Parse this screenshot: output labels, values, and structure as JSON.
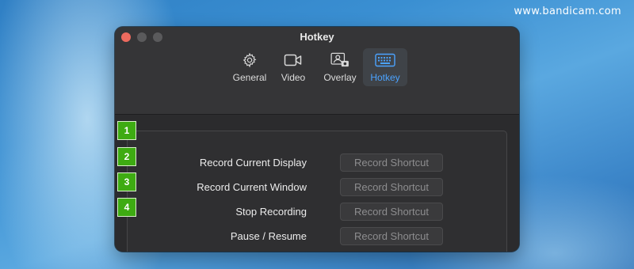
{
  "watermark": "www.bandicam.com",
  "window": {
    "title": "Hotkey"
  },
  "tabs": [
    {
      "label": "General",
      "icon": "gear-icon",
      "active": false
    },
    {
      "label": "Video",
      "icon": "video-camera-icon",
      "active": false
    },
    {
      "label": "Overlay",
      "icon": "overlay-photo-icon",
      "active": false
    },
    {
      "label": "Hotkey",
      "icon": "keyboard-icon",
      "active": true
    }
  ],
  "hotkeys": [
    {
      "badge": "1",
      "label": "Record Current Display",
      "button": "Record Shortcut"
    },
    {
      "badge": "2",
      "label": "Record Current Window",
      "button": "Record Shortcut"
    },
    {
      "badge": "3",
      "label": "Stop Recording",
      "button": "Record Shortcut"
    },
    {
      "badge": "4",
      "label": "Pause / Resume",
      "button": "Record Shortcut"
    }
  ],
  "colors": {
    "accent": "#4ba3ff",
    "badge": "#3eab12",
    "close": "#ed6a5e"
  }
}
